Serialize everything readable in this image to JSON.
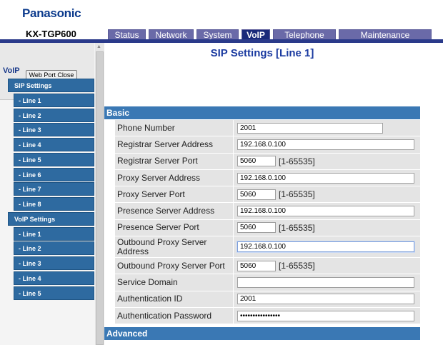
{
  "header": {
    "brand": "Panasonic",
    "model": "KX-TGP600",
    "tabs": [
      {
        "label": "Status",
        "active": false
      },
      {
        "label": "Network",
        "active": false
      },
      {
        "label": "System",
        "active": false
      },
      {
        "label": "VoIP",
        "active": true
      },
      {
        "label": "Telephone",
        "active": false
      },
      {
        "label": "Maintenance",
        "active": false
      }
    ]
  },
  "sidebar": {
    "web_port_close": "Web Port Close",
    "section_title": "VoIP",
    "items": [
      {
        "label": "SIP Settings",
        "kind": "group"
      },
      {
        "label": "- Line 1",
        "kind": "sub"
      },
      {
        "label": "- Line 2",
        "kind": "sub"
      },
      {
        "label": "- Line 3",
        "kind": "sub"
      },
      {
        "label": "- Line 4",
        "kind": "sub"
      },
      {
        "label": "- Line 5",
        "kind": "sub"
      },
      {
        "label": "- Line 6",
        "kind": "sub"
      },
      {
        "label": "- Line 7",
        "kind": "sub"
      },
      {
        "label": "- Line 8",
        "kind": "sub"
      },
      {
        "label": "VoIP Settings",
        "kind": "group"
      },
      {
        "label": "- Line 1",
        "kind": "sub"
      },
      {
        "label": "- Line 2",
        "kind": "sub"
      },
      {
        "label": "- Line 3",
        "kind": "sub"
      },
      {
        "label": "- Line 4",
        "kind": "sub"
      },
      {
        "label": "- Line 5",
        "kind": "sub"
      }
    ]
  },
  "main": {
    "title": "SIP Settings [Line 1]",
    "basic_label": "Basic",
    "advanced_label": "Advanced",
    "fields": [
      {
        "label": "Phone Number",
        "value": "2001",
        "size": "mid"
      },
      {
        "label": "Registrar Server Address",
        "value": "192.168.0.100",
        "size": "long"
      },
      {
        "label": "Registrar Server Port",
        "value": "5060",
        "size": "short",
        "range": "[1-65535]"
      },
      {
        "label": "Proxy Server Address",
        "value": "192.168.0.100",
        "size": "long"
      },
      {
        "label": "Proxy Server Port",
        "value": "5060",
        "size": "short",
        "range": "[1-65535]"
      },
      {
        "label": "Presence Server Address",
        "value": "192.168.0.100",
        "size": "long"
      },
      {
        "label": "Presence Server Port",
        "value": "5060",
        "size": "short",
        "range": "[1-65535]"
      },
      {
        "label": "Outbound Proxy Server Address",
        "value": "192.168.0.100",
        "size": "long",
        "tall": true,
        "focus": true
      },
      {
        "label": "Outbound Proxy Server Port",
        "value": "5060",
        "size": "short",
        "range": "[1-65535]"
      },
      {
        "label": "Service Domain",
        "value": "",
        "size": "long"
      },
      {
        "label": "Authentication ID",
        "value": "2001",
        "size": "long"
      },
      {
        "label": "Authentication Password",
        "value": "••••••••••••••••",
        "size": "long"
      }
    ]
  }
}
